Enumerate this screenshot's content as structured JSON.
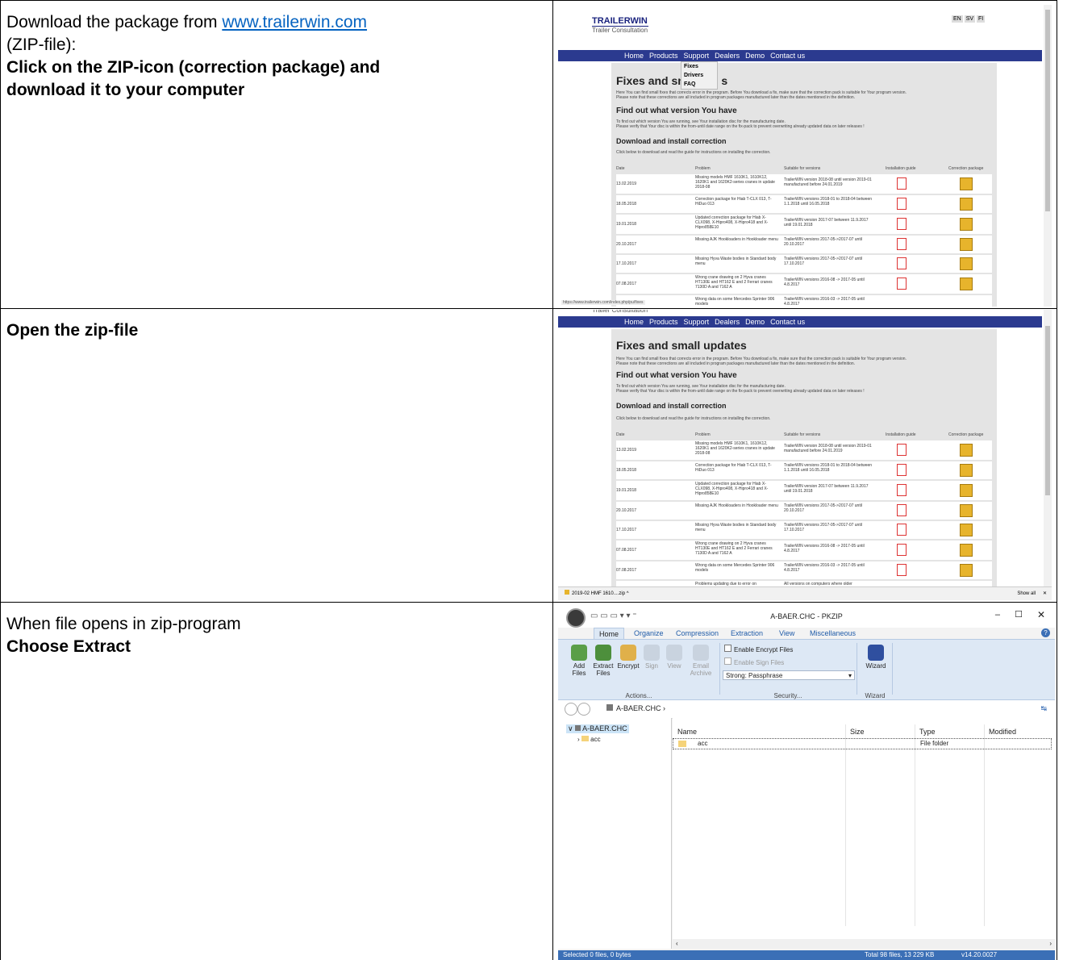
{
  "rows": [
    {
      "left": {
        "line1_prefix": "Download the package from ",
        "line1_link": "www.trailerwin.com",
        "line2": "(ZIP-file):",
        "bold_line1": "Click on the ZIP-icon (correction package) and",
        "bold_line2": "download it to your computer"
      }
    },
    {
      "left": {
        "bold_line1": "Open the zip-file"
      }
    },
    {
      "left": {
        "line1": "When file opens in zip-program",
        "bold_line1": "Choose Extract"
      }
    }
  ],
  "site": {
    "logo": "TRAILERWIN",
    "logo_sub": "Trailer Consultation",
    "languages": [
      "EN",
      "SV",
      "FI"
    ],
    "nav": [
      "Home",
      "Products",
      "Support",
      "Dealers",
      "Demo",
      "Contact us"
    ],
    "dropdown": [
      "Fixes",
      "Drivers",
      "FAQ"
    ],
    "title": "Fixes and small updates",
    "title_partial_a": "Fixes and smal",
    "title_partial_b": "s",
    "intro1": "Here You can find small fixes that corrects error in the program. Before You download a fix, make sure that the correction pack is suitable for Your program version.",
    "intro2": "Please note that these corrections are all included in program packages manufactured later than the dates mentioned in the definition.",
    "h2": "Find out what version You have",
    "t2a": "To find out which version You are running, see Your installation disc for the manufacturing date.",
    "t2b": "Please verify that Your disc is within the from-until date range on the fix-pack to prevent overwriting already updated data on later releases !",
    "h3": "Download and install correction",
    "t3": "Click below to download and read the guide for instructions on installing the correction.",
    "headers": [
      "Date",
      "Problem",
      "Suitable for versions",
      "Installation guide",
      "Correction package"
    ],
    "table": [
      {
        "date": "13.02.2019",
        "problem": "Missing models HMF 1610K1, 1610K12, 1620K1 and 1620K2-series cranes in update 2018-08",
        "versions": "TrailerWIN version 2018-08 until version 2019-01 manufactured before 24.01.2019"
      },
      {
        "date": "18.05.2018",
        "problem": "Correction package for Hiab T-CLX 013, T-HiDuo 013",
        "versions": "TrailerWIN versions 2018-01 to 2018-04 between 1.1.2018 until 16.05.2018"
      },
      {
        "date": "19.01.2018",
        "problem": "Updated correction package for Hiab X-CLX098, X-Hipro408, X-Hipro418 and X-Hipro858E10",
        "versions": "TrailerWIN version 2017-07 between 11.9.2017 until 19.01.2018"
      },
      {
        "date": "20.10.2017",
        "problem": "Missing AJK Hookloaders in Hookloader menu",
        "versions": "TrailerWIN versions 2017-05->2017-07 until 20.10.2017"
      },
      {
        "date": "17.10.2017",
        "problem": "Missing Hyva Waste bodies in Standard body menu",
        "versions": "TrailerWIN versions 2017-05->2017-07 until 17.10.2017"
      },
      {
        "date": "07.08.2017",
        "problem": "Wrong crane drawing on 2 Hyva cranes HT130E and HT162 E and 2 Ferrari cranes 7130D A and 7162 A",
        "versions": "TrailerWIN versions 2016-08 -> 2017-05 until 4.8.2017"
      },
      {
        "date": "07.08.2017",
        "problem": "Wrong data on some Mercedes Sprinter 906 models",
        "versions": "TrailerWIN versions 2016-03 -> 2017-05 until 4.8.2017"
      }
    ],
    "row8_problem": "Problems updating due to error on",
    "row8_versions": "All versions on computers where older",
    "status_url": "https://www.trailerwin.com/index.php/pu/fixes",
    "download_file": "2019-02 HMF 1610....zip",
    "show_all": "Show all"
  },
  "pkzip": {
    "title": "A-BAER.CHC - PKZIP",
    "tabs": [
      "Home",
      "Organize",
      "Compression",
      "Extraction",
      "View",
      "Miscellaneous"
    ],
    "buttons": [
      "Add Files",
      "Extract Files",
      "Encrypt",
      "Sign",
      "View",
      "Email Archive"
    ],
    "checks": [
      "Enable Encrypt Files",
      "Enable Sign Files"
    ],
    "strength": "Strong: Passphrase",
    "wizard": "Wizard",
    "groups": [
      "Actions...",
      "Security...",
      "Wizard"
    ],
    "path": "A-BAER.CHC",
    "tree_root": "A-BAER.CHC",
    "tree_child": "acc",
    "columns": [
      "Name",
      "Size",
      "Type",
      "Modified"
    ],
    "file_name": "acc",
    "file_type": "File folder",
    "status_left": "Selected 0 files, 0 bytes",
    "status_total": "Total 98 files, 13 229 KB",
    "status_version": "v14.20.0027"
  },
  "colors": {
    "nav": "#2b3a8f",
    "link": "#0563c1",
    "pk_status": "#3b6fb6"
  }
}
